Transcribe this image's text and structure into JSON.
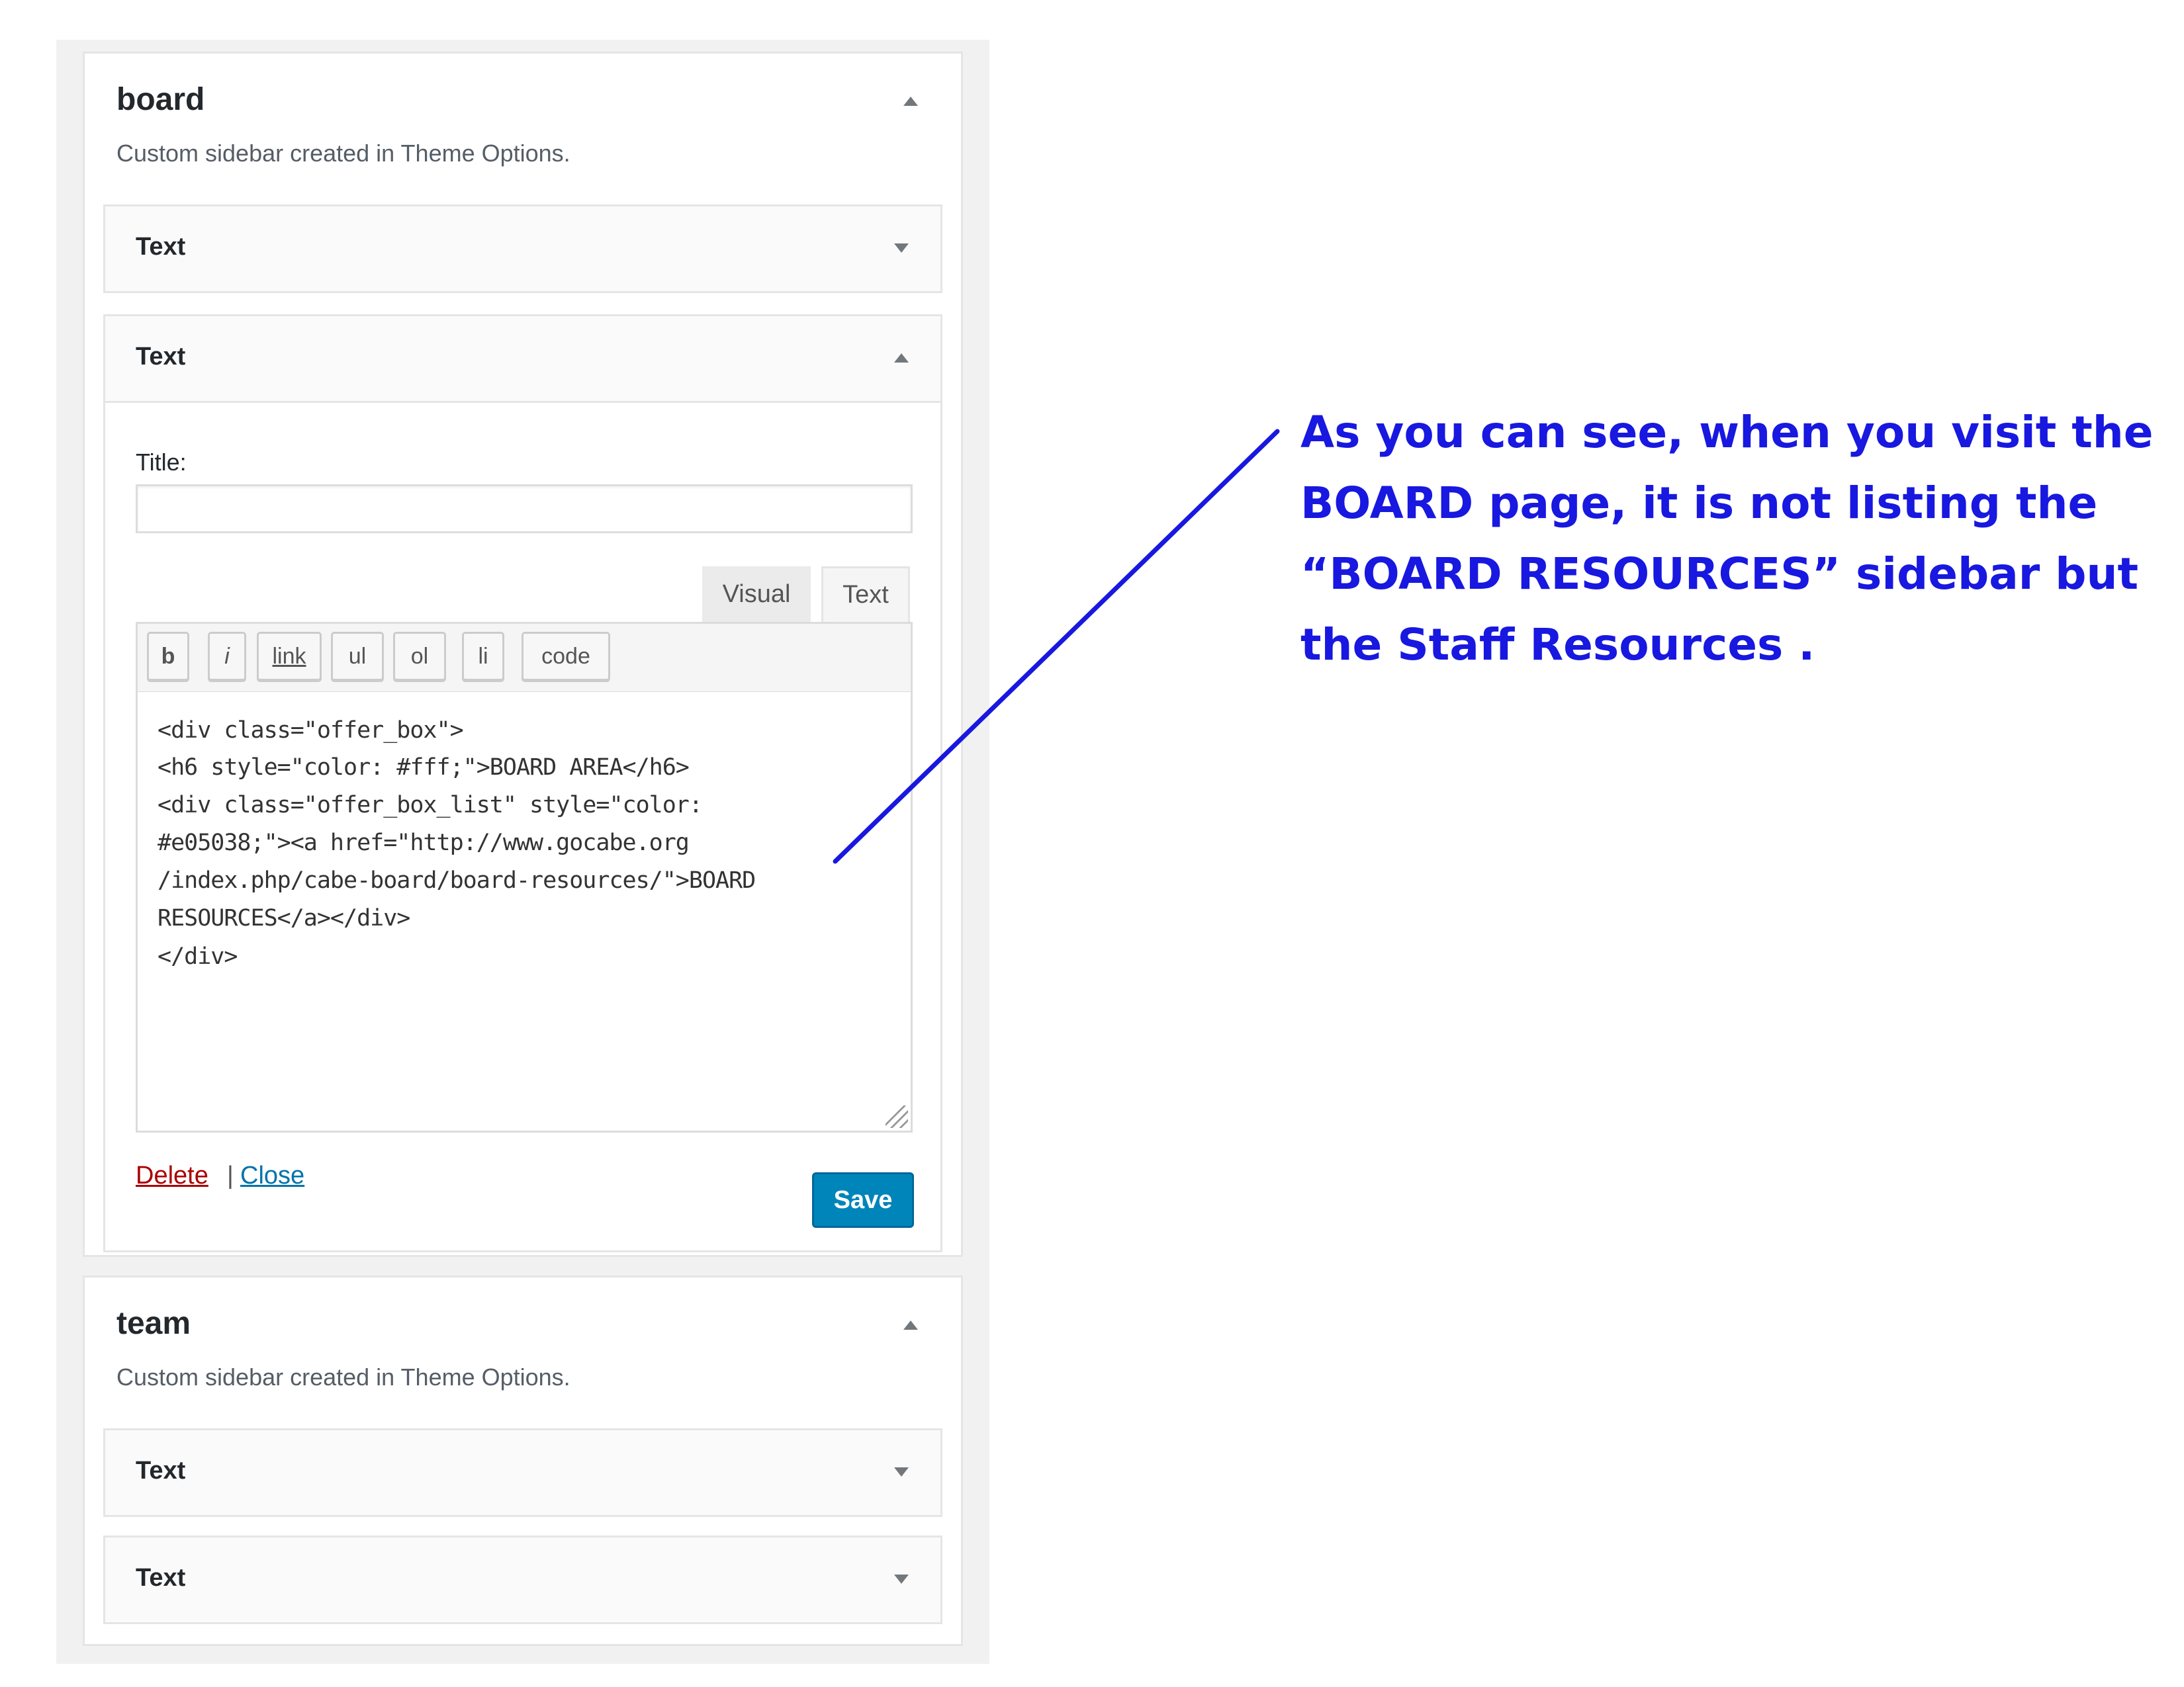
{
  "colors": {
    "annotation": "#1818e0",
    "save_button": "#0085ba",
    "delete_link": "#a00000",
    "close_link": "#0073aa"
  },
  "board_area": {
    "title": "board",
    "description": "Custom sidebar created in Theme Options.",
    "toggle_icon": "arrow-up-icon",
    "widgets": [
      {
        "title": "Text",
        "state": "collapsed"
      },
      {
        "title": "Text",
        "state": "expanded",
        "title_label": "Title:",
        "title_value": "",
        "tabs": [
          "Visual",
          "Text"
        ],
        "quicktags": [
          "b",
          "i",
          "link",
          "ul",
          "ol",
          "li",
          "code"
        ],
        "content_lines": [
          "<div class=\"offer_box\">",
          "<h6 style=\"color: #fff;\">BOARD AREA</h6>",
          "<div class=\"offer_box_list\" style=\"color:",
          "#e05038;\"><a href=\"http://www.gocabe.org",
          "/index.php/cabe-board/board-resources/\">BOARD",
          "RESOURCES</a></div>",
          "</div>"
        ],
        "delete_label": "Delete",
        "separator": "|",
        "close_label": "Close",
        "save_label": "Save"
      }
    ]
  },
  "team_area": {
    "title": "team",
    "description": "Custom sidebar created in Theme Options.",
    "toggle_icon": "arrow-up-icon",
    "widgets": [
      {
        "title": "Text",
        "state": "collapsed"
      },
      {
        "title": "Text",
        "state": "collapsed"
      }
    ]
  },
  "annotation": {
    "lines": [
      "As you can see, when you visit the",
      "BOARD page, it is not listing the",
      "“BOARD RESOURCES” sidebar but",
      "the Staff Resources ."
    ]
  }
}
